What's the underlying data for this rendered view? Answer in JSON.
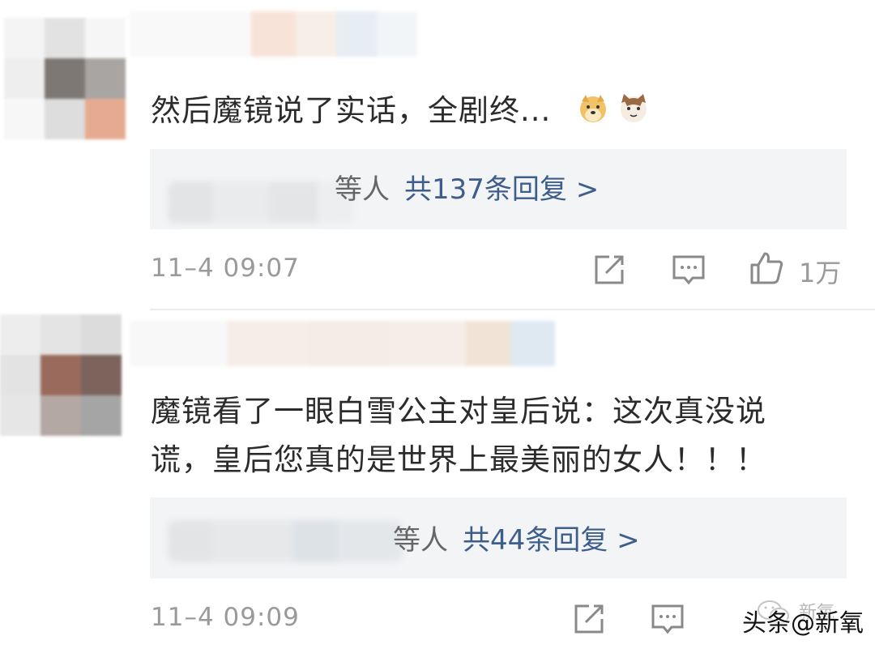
{
  "comments": [
    {
      "text": "然后魔镜说了实话，全剧终...",
      "emojis": [
        "doge-emoji",
        "cat-emoji"
      ],
      "reply": {
        "suffix": "等人",
        "count_label": "共137条回复 >"
      },
      "timestamp": "11–4 09:07",
      "like_count": "1万"
    },
    {
      "text_line1": "魔镜看了一眼白雪公主对皇后说：这次真没说",
      "text_line2": "谎，皇后您真的是世界上最美丽的女人！！！",
      "reply": {
        "suffix": "等人",
        "count_label": "共44条回复 >"
      },
      "timestamp": "11–4 09:09"
    }
  ],
  "watermark": {
    "text": "头条@新氧",
    "small": "新氧"
  },
  "colors": {
    "link": "#3d5e8a",
    "meta": "#9a9a9a",
    "reply_bg": "#f3f4f6"
  },
  "icons": [
    "forward-icon",
    "comment-icon",
    "like-icon",
    "wechat-icon"
  ]
}
